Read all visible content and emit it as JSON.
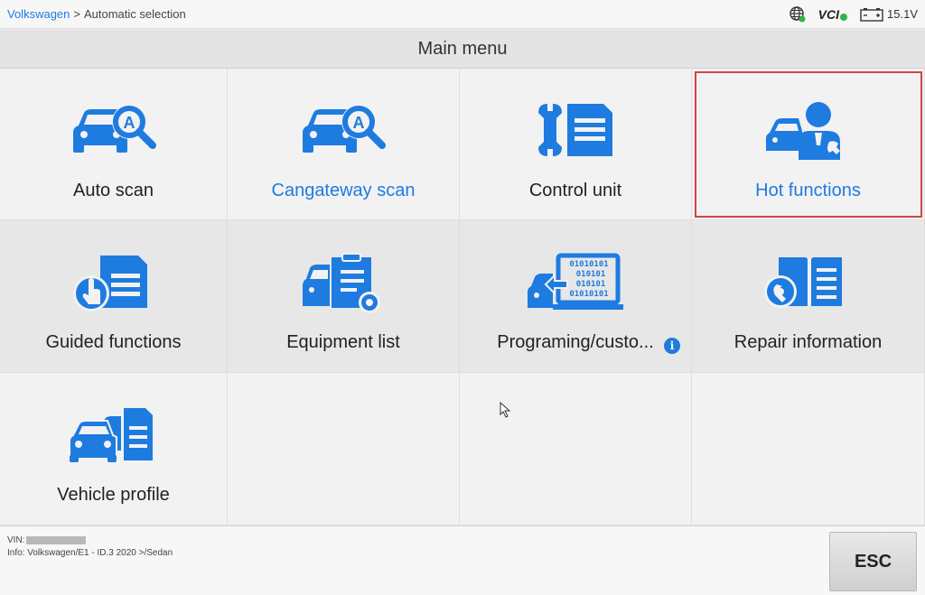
{
  "breadcrumb": {
    "brand": "Volkswagen",
    "separator": ">",
    "current": "Automatic selection"
  },
  "status": {
    "vci_label": "VCI",
    "battery_voltage": "15.1V",
    "vci_connected": true,
    "network_connected": true
  },
  "title": "Main menu",
  "tiles": [
    {
      "label": "Auto scan",
      "icon": "car-search-icon",
      "highlight": false
    },
    {
      "label": "Cangateway scan",
      "icon": "car-search-icon",
      "highlight": true
    },
    {
      "label": "Control unit",
      "icon": "wrench-document-icon",
      "highlight": false
    },
    {
      "label": "Hot functions",
      "icon": "car-technician-icon",
      "highlight": true,
      "selected": true
    },
    {
      "label": "Guided functions",
      "icon": "hand-document-icon",
      "highlight": false
    },
    {
      "label": "Equipment list",
      "icon": "car-clipboard-icon",
      "highlight": false
    },
    {
      "label": "Programing/custo...",
      "icon": "car-binary-icon",
      "highlight": false,
      "info": "i"
    },
    {
      "label": "Repair information",
      "icon": "wrench-book-icon",
      "highlight": false
    },
    {
      "label": "Vehicle profile",
      "icon": "cars-document-icon",
      "highlight": false
    }
  ],
  "footer": {
    "vin_label": "VIN:",
    "info": "Info: Volkswagen/E1 - ID.3 2020 >/Sedan",
    "esc_label": "ESC"
  },
  "colors": {
    "accent": "#1e7be0",
    "selection": "#d34545",
    "status_ok": "#2fb34a"
  }
}
